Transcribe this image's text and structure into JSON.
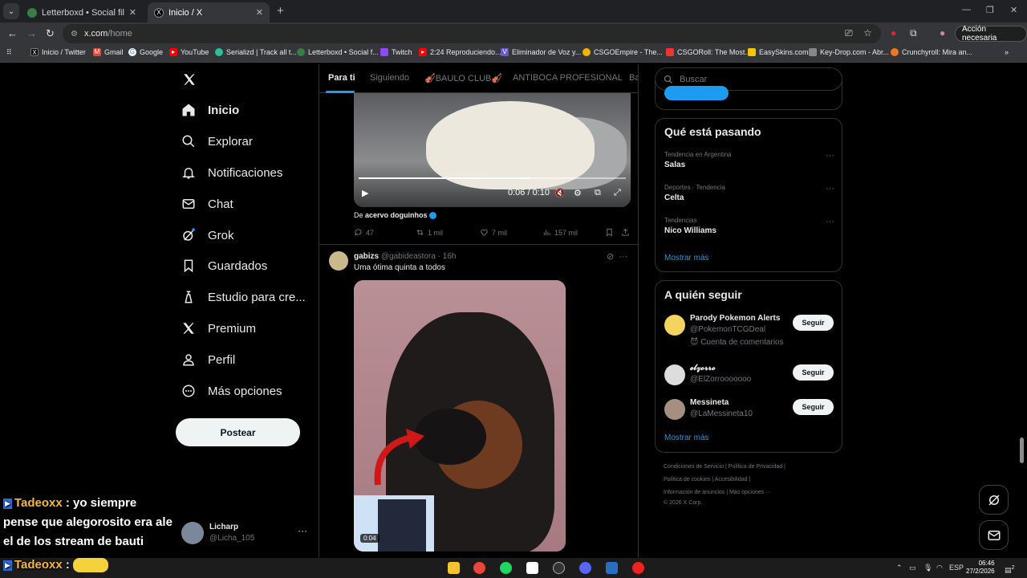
{
  "browser": {
    "tabs": [
      {
        "label": "Letterboxd • Social film discove",
        "active": false
      },
      {
        "label": "Inicio / X",
        "active": true
      }
    ],
    "url_main": "x.com",
    "url_path": "/home",
    "action_button": "Acción necesaria",
    "bookmarks": [
      "Inicio / Twitter",
      "Gmail",
      "Google",
      "YouTube",
      "Serializd | Track all t...",
      "Letterboxd • Social f...",
      "Twitch",
      "2:24 Reproduciendo...",
      "Eliminador de Voz y...",
      "CSGOEmpire - The...",
      "CSGORoll: The Most...",
      "EasySkins.com",
      "Key-Drop.com - Abr...",
      "Crunchyroll: Mira an..."
    ]
  },
  "sidebar": {
    "items": [
      {
        "label": "Inicio"
      },
      {
        "label": "Explorar"
      },
      {
        "label": "Notificaciones"
      },
      {
        "label": "Chat"
      },
      {
        "label": "Grok"
      },
      {
        "label": "Guardados"
      },
      {
        "label": "Estudio para cre..."
      },
      {
        "label": "Premium"
      },
      {
        "label": "Perfil"
      },
      {
        "label": "Más opciones"
      }
    ],
    "post_button": "Postear",
    "account": {
      "name": "Licharp",
      "handle": "@Licha_105"
    }
  },
  "overlay_chat": {
    "user": "Tadeoxx",
    "message_line1": ": yo siempre",
    "message_line2": "pense que alegorosito era ale",
    "message_line3": "el de los stream de bauti",
    "user2": "Tadeoxx",
    "colon2": ":"
  },
  "feed": {
    "tabs": [
      "Para ti",
      "Siguiendo",
      "🎻BAULO CLUB🎻",
      "ANTIBOCA PROFESIONAL",
      "Ba"
    ],
    "video": {
      "time": "0:06 / 0:10",
      "progress": 0.64
    },
    "from_prefix": "De",
    "from_account": "acervo doguinhos",
    "stats": {
      "replies": "47",
      "reposts": "1 mil",
      "likes": "7 mil",
      "views": "157 mil"
    },
    "tweet": {
      "name": "gabizs",
      "handle": "@gabideastora",
      "time": "· 16h",
      "text": "Uma ótima quinta a todos",
      "media_time": "0:04"
    }
  },
  "right": {
    "search_placeholder": "Buscar",
    "trends_title": "Qué está pasando",
    "trends": [
      {
        "context": "Tendencia en Argentina",
        "topic": "Salas"
      },
      {
        "context": "Deportes · Tendencia",
        "topic": "Celta"
      },
      {
        "context": "Tendencias",
        "topic": "Nico Williams"
      }
    ],
    "show_more": "Mostrar más",
    "follow_title": "A quién seguir",
    "follow": [
      {
        "name": "Parody Pokemon Alerts",
        "handle": "@PokemonTCGDeal",
        "extra": "😈 Cuenta de comentarios",
        "button": "Seguir"
      },
      {
        "name": "𝓮𝓵𝔃𝓸𝓻𝓻𝓸",
        "handle": "@ElZorrooooooo",
        "button": "Seguir"
      },
      {
        "name": "Messineta",
        "handle": "@LaMessineta10",
        "button": "Seguir"
      }
    ],
    "footer": {
      "line1": "Condiciones de Servicio  |  Política de Privacidad  |",
      "line2": "Política de cookies  |  Accesibilidad  |",
      "line3": "Información de anuncios  |  Más opciones ···",
      "line4": "© 2026 X Corp."
    }
  },
  "taskbar": {
    "lang": "ESP",
    "time": "06:46",
    "date": "27/2/2026",
    "notif": "2"
  }
}
